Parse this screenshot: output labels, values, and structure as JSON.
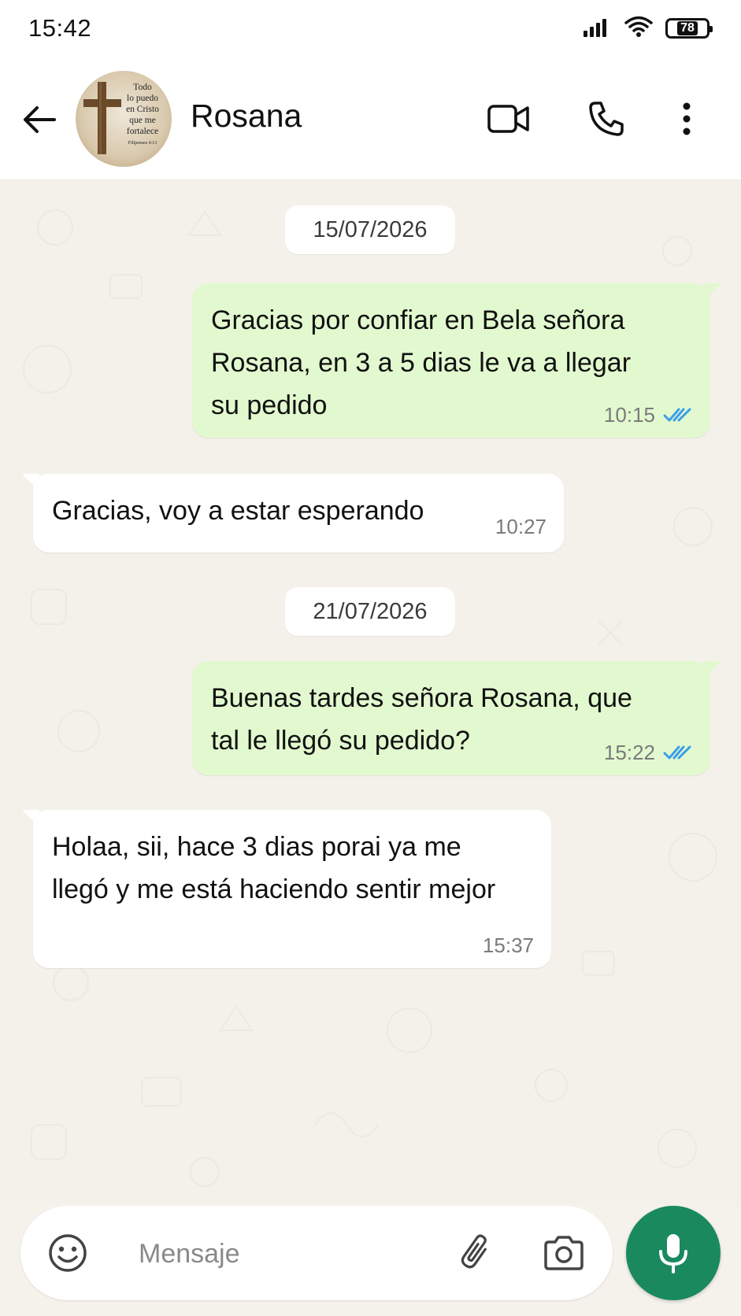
{
  "status_bar": {
    "time": "15:42",
    "battery_level": "78"
  },
  "header": {
    "contact_name": "Rosana",
    "avatar_text": [
      "Todo",
      "lo puedo",
      "en Cristo",
      "que me",
      "fortalece",
      "Filipenses 4:13"
    ]
  },
  "messages": [
    {
      "type": "date",
      "text": "15/07/2026"
    },
    {
      "type": "outgoing",
      "text": "Gracias por confiar en Bela señora\nRosana, en 3 a 5 dias le va a llegar\nsu pedido",
      "time": "10:15",
      "status": "read"
    },
    {
      "type": "incoming",
      "text": "Gracias, voy a estar esperando",
      "time": "10:27"
    },
    {
      "type": "date",
      "text": "21/07/2026"
    },
    {
      "type": "outgoing",
      "text": "Buenas tardes señora Rosana, que\ntal le llegó su pedido?",
      "time": "15:22",
      "status": "read"
    },
    {
      "type": "incoming",
      "text": "Holaa, sii, hace 3 dias porai ya me\nllegó y me está haciendo sentir mejor",
      "time": "15:37"
    }
  ],
  "composer": {
    "placeholder": "Mensaje"
  },
  "colors": {
    "outgoing_bubble": "#e2f9cf",
    "incoming_bubble": "#ffffff",
    "chat_background": "#f4f1ea",
    "mic_button": "#1a8a5e",
    "read_ticks": "#3b9ee8"
  },
  "icons": {
    "back": "arrow-left-icon",
    "video": "video-call-icon",
    "phone": "phone-icon",
    "menu": "more-vertical-icon",
    "emoji": "emoji-icon",
    "attach": "paperclip-icon",
    "camera": "camera-icon",
    "mic": "microphone-icon",
    "signal": "signal-icon",
    "wifi": "wifi-icon",
    "battery": "battery-icon"
  }
}
